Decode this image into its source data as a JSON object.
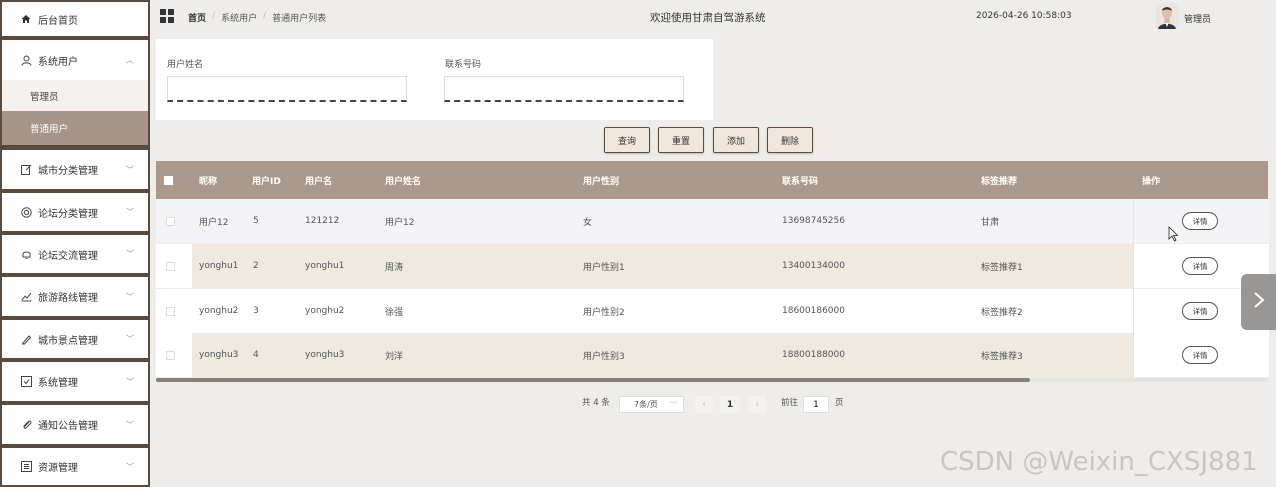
{
  "sidebar": {
    "items": [
      {
        "label": "后台首页",
        "icon": "home-icon"
      },
      {
        "label": "系统用户",
        "icon": "user-icon",
        "expanded": true
      },
      {
        "label": "城市分类管理",
        "icon": "edit-icon"
      },
      {
        "label": "论坛分类管理",
        "icon": "copyright-icon"
      },
      {
        "label": "论坛交流管理",
        "icon": "bell-icon"
      },
      {
        "label": "旅游路线管理",
        "icon": "chart-icon"
      },
      {
        "label": "城市景点管理",
        "icon": "pen-icon"
      },
      {
        "label": "系统管理",
        "icon": "checkbox-icon"
      },
      {
        "label": "通知公告管理",
        "icon": "paperclip-icon"
      },
      {
        "label": "资源管理",
        "icon": "list-icon"
      }
    ],
    "subitems": [
      {
        "label": "管理员",
        "active": false
      },
      {
        "label": "普通用户",
        "active": true
      }
    ]
  },
  "header": {
    "breadcrumb": [
      "首页",
      "系统用户",
      "普通用户列表"
    ],
    "welcome": "欢迎使用甘肃自驾游系统",
    "datetime": "2026-04-26 10:58:03",
    "user": "管理员"
  },
  "search": {
    "fields": [
      {
        "label": "用户姓名",
        "value": "",
        "placeholder": ""
      },
      {
        "label": "联系号码",
        "value": "",
        "placeholder": ""
      }
    ]
  },
  "actions": {
    "query": "查询",
    "reset": "重置",
    "add": "添加",
    "delete": "删除"
  },
  "table": {
    "columns": [
      "昵称",
      "用户ID",
      "用户名",
      "用户姓名",
      "用户性别",
      "联系号码",
      "标签推荐",
      "操作"
    ],
    "rows": [
      [
        "用户12",
        "5",
        "121212",
        "用户12",
        "女",
        "13698745256",
        "甘肃"
      ],
      [
        "yonghu1",
        "2",
        "yonghu1",
        "周涛",
        "用户性别1",
        "13400134000",
        "标签推荐1"
      ],
      [
        "yonghu2",
        "3",
        "yonghu2",
        "徐强",
        "用户性别2",
        "18600186000",
        "标签推荐2"
      ],
      [
        "yonghu3",
        "4",
        "yonghu3",
        "刘洋",
        "用户性别3",
        "18800188000",
        "标签推荐3"
      ]
    ],
    "detail_label": "详情"
  },
  "pagination": {
    "total": "共 4 条",
    "page_size": "7条/页",
    "current": "1",
    "goto_label": "前往",
    "goto_value": "1",
    "page_unit": "页"
  },
  "watermark": "CSDN @Weixin_CXSJ881",
  "colors": {
    "sidebar": "#5b4a3e",
    "table_header": "#ab9a8b",
    "active_sub": "#a8958a",
    "row_alt": "#efe9df"
  }
}
